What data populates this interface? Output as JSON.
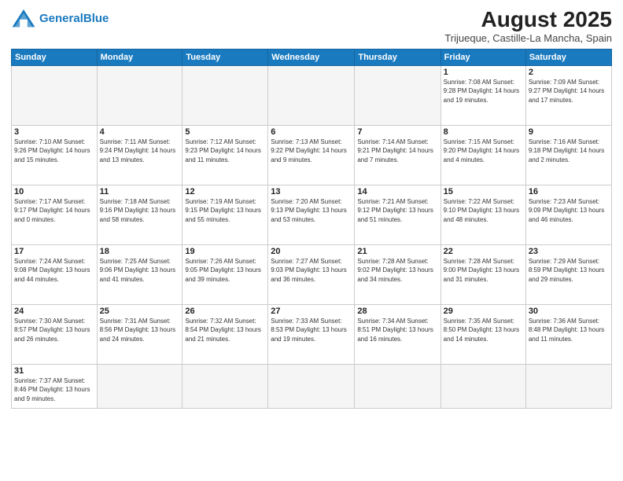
{
  "header": {
    "logo_general": "General",
    "logo_blue": "Blue",
    "month_title": "August 2025",
    "subtitle": "Trijueque, Castille-La Mancha, Spain"
  },
  "weekdays": [
    "Sunday",
    "Monday",
    "Tuesday",
    "Wednesday",
    "Thursday",
    "Friday",
    "Saturday"
  ],
  "weeks": [
    [
      {
        "day": "",
        "empty": true
      },
      {
        "day": "",
        "empty": true
      },
      {
        "day": "",
        "empty": true
      },
      {
        "day": "",
        "empty": true
      },
      {
        "day": "",
        "empty": true
      },
      {
        "day": "1",
        "info": "Sunrise: 7:08 AM\nSunset: 9:28 PM\nDaylight: 14 hours\nand 19 minutes."
      },
      {
        "day": "2",
        "info": "Sunrise: 7:09 AM\nSunset: 9:27 PM\nDaylight: 14 hours\nand 17 minutes."
      }
    ],
    [
      {
        "day": "3",
        "info": "Sunrise: 7:10 AM\nSunset: 9:26 PM\nDaylight: 14 hours\nand 15 minutes."
      },
      {
        "day": "4",
        "info": "Sunrise: 7:11 AM\nSunset: 9:24 PM\nDaylight: 14 hours\nand 13 minutes."
      },
      {
        "day": "5",
        "info": "Sunrise: 7:12 AM\nSunset: 9:23 PM\nDaylight: 14 hours\nand 11 minutes."
      },
      {
        "day": "6",
        "info": "Sunrise: 7:13 AM\nSunset: 9:22 PM\nDaylight: 14 hours\nand 9 minutes."
      },
      {
        "day": "7",
        "info": "Sunrise: 7:14 AM\nSunset: 9:21 PM\nDaylight: 14 hours\nand 7 minutes."
      },
      {
        "day": "8",
        "info": "Sunrise: 7:15 AM\nSunset: 9:20 PM\nDaylight: 14 hours\nand 4 minutes."
      },
      {
        "day": "9",
        "info": "Sunrise: 7:16 AM\nSunset: 9:18 PM\nDaylight: 14 hours\nand 2 minutes."
      }
    ],
    [
      {
        "day": "10",
        "info": "Sunrise: 7:17 AM\nSunset: 9:17 PM\nDaylight: 14 hours\nand 0 minutes."
      },
      {
        "day": "11",
        "info": "Sunrise: 7:18 AM\nSunset: 9:16 PM\nDaylight: 13 hours\nand 58 minutes."
      },
      {
        "day": "12",
        "info": "Sunrise: 7:19 AM\nSunset: 9:15 PM\nDaylight: 13 hours\nand 55 minutes."
      },
      {
        "day": "13",
        "info": "Sunrise: 7:20 AM\nSunset: 9:13 PM\nDaylight: 13 hours\nand 53 minutes."
      },
      {
        "day": "14",
        "info": "Sunrise: 7:21 AM\nSunset: 9:12 PM\nDaylight: 13 hours\nand 51 minutes."
      },
      {
        "day": "15",
        "info": "Sunrise: 7:22 AM\nSunset: 9:10 PM\nDaylight: 13 hours\nand 48 minutes."
      },
      {
        "day": "16",
        "info": "Sunrise: 7:23 AM\nSunset: 9:09 PM\nDaylight: 13 hours\nand 46 minutes."
      }
    ],
    [
      {
        "day": "17",
        "info": "Sunrise: 7:24 AM\nSunset: 9:08 PM\nDaylight: 13 hours\nand 44 minutes."
      },
      {
        "day": "18",
        "info": "Sunrise: 7:25 AM\nSunset: 9:06 PM\nDaylight: 13 hours\nand 41 minutes."
      },
      {
        "day": "19",
        "info": "Sunrise: 7:26 AM\nSunset: 9:05 PM\nDaylight: 13 hours\nand 39 minutes."
      },
      {
        "day": "20",
        "info": "Sunrise: 7:27 AM\nSunset: 9:03 PM\nDaylight: 13 hours\nand 36 minutes."
      },
      {
        "day": "21",
        "info": "Sunrise: 7:28 AM\nSunset: 9:02 PM\nDaylight: 13 hours\nand 34 minutes."
      },
      {
        "day": "22",
        "info": "Sunrise: 7:28 AM\nSunset: 9:00 PM\nDaylight: 13 hours\nand 31 minutes."
      },
      {
        "day": "23",
        "info": "Sunrise: 7:29 AM\nSunset: 8:59 PM\nDaylight: 13 hours\nand 29 minutes."
      }
    ],
    [
      {
        "day": "24",
        "info": "Sunrise: 7:30 AM\nSunset: 8:57 PM\nDaylight: 13 hours\nand 26 minutes."
      },
      {
        "day": "25",
        "info": "Sunrise: 7:31 AM\nSunset: 8:56 PM\nDaylight: 13 hours\nand 24 minutes."
      },
      {
        "day": "26",
        "info": "Sunrise: 7:32 AM\nSunset: 8:54 PM\nDaylight: 13 hours\nand 21 minutes."
      },
      {
        "day": "27",
        "info": "Sunrise: 7:33 AM\nSunset: 8:53 PM\nDaylight: 13 hours\nand 19 minutes."
      },
      {
        "day": "28",
        "info": "Sunrise: 7:34 AM\nSunset: 8:51 PM\nDaylight: 13 hours\nand 16 minutes."
      },
      {
        "day": "29",
        "info": "Sunrise: 7:35 AM\nSunset: 8:50 PM\nDaylight: 13 hours\nand 14 minutes."
      },
      {
        "day": "30",
        "info": "Sunrise: 7:36 AM\nSunset: 8:48 PM\nDaylight: 13 hours\nand 11 minutes."
      }
    ],
    [
      {
        "day": "31",
        "info": "Sunrise: 7:37 AM\nSunset: 8:46 PM\nDaylight: 13 hours\nand 9 minutes."
      },
      {
        "day": "",
        "empty": true
      },
      {
        "day": "",
        "empty": true
      },
      {
        "day": "",
        "empty": true
      },
      {
        "day": "",
        "empty": true
      },
      {
        "day": "",
        "empty": true
      },
      {
        "day": "",
        "empty": true
      }
    ]
  ]
}
